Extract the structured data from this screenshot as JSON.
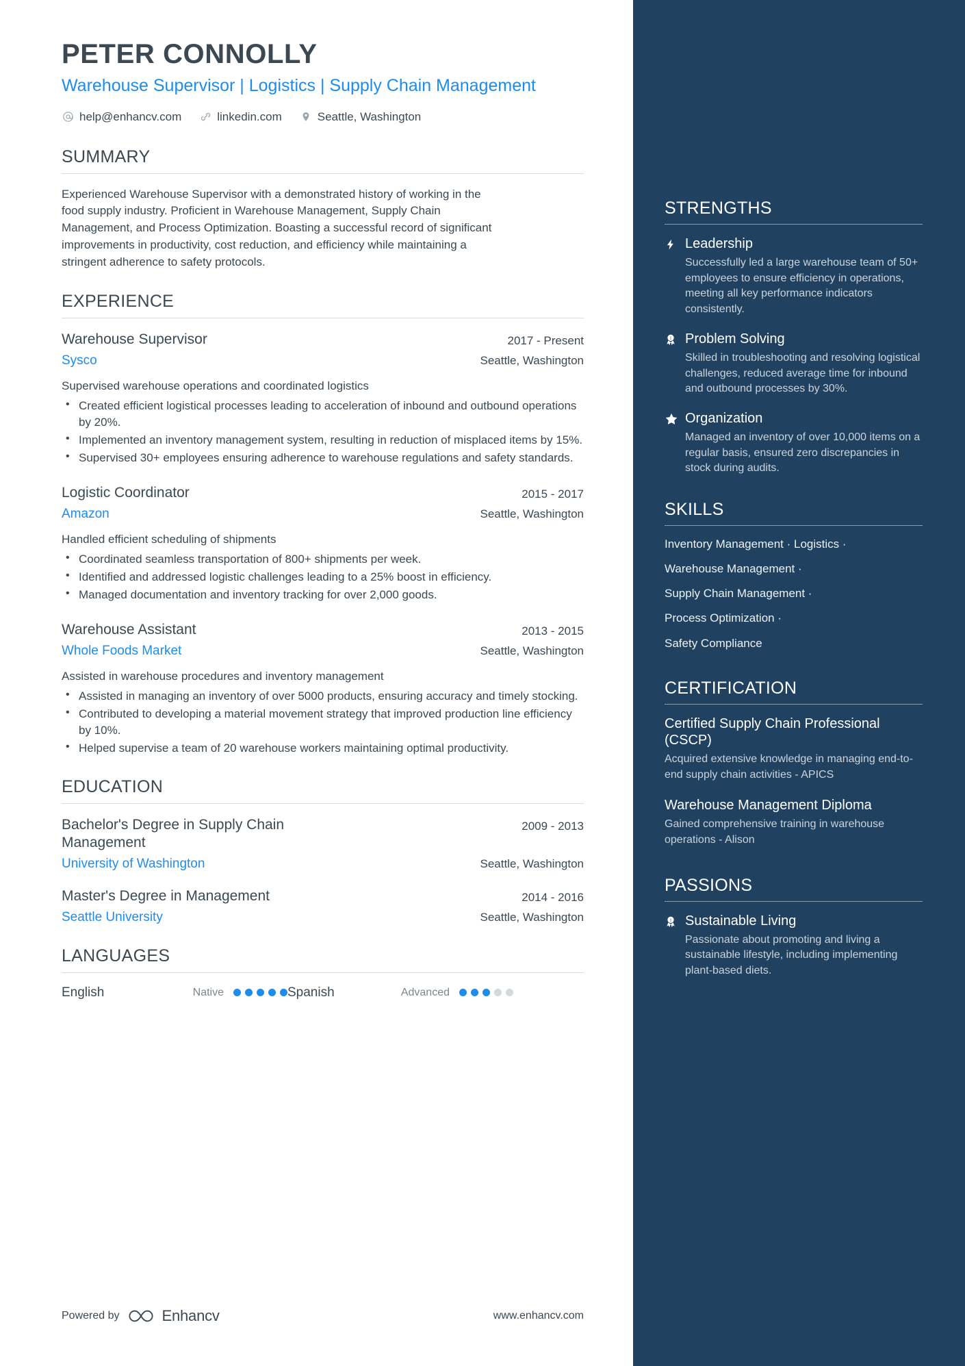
{
  "colors": {
    "accent_blue": "#1f8ceb",
    "sidebar_bg": "#20415f",
    "text_dark": "#3c4852",
    "muted": "#7b868e",
    "sidebar_text_muted": "#cbd4dc"
  },
  "header": {
    "name": "PETER CONNOLLY",
    "headline": "Warehouse Supervisor | Logistics | Supply Chain Management",
    "contacts": [
      {
        "icon": "email-icon",
        "text": "help@enhancv.com"
      },
      {
        "icon": "link-icon",
        "text": "linkedin.com"
      },
      {
        "icon": "location-pin-icon",
        "text": "Seattle, Washington"
      }
    ]
  },
  "summary": {
    "title": "SUMMARY",
    "text": "Experienced Warehouse Supervisor with a demonstrated history of working in the food supply industry. Proficient in Warehouse Management, Supply Chain Management, and Process Optimization. Boasting a successful record of significant improvements in productivity, cost reduction, and efficiency while maintaining a stringent adherence to safety protocols."
  },
  "experience": {
    "title": "EXPERIENCE",
    "entries": [
      {
        "role": "Warehouse Supervisor",
        "date": "2017 - Present",
        "company": "Sysco",
        "location": "Seattle, Washington",
        "description": "Supervised warehouse operations and coordinated logistics",
        "bullets": [
          "Created efficient logistical processes leading to acceleration of inbound and outbound operations by 20%.",
          "Implemented an inventory management system, resulting in reduction of misplaced items by 15%.",
          "Supervised 30+ employees ensuring adherence to warehouse regulations and safety standards."
        ]
      },
      {
        "role": "Logistic Coordinator",
        "date": "2015 - 2017",
        "company": "Amazon",
        "location": "Seattle, Washington",
        "description": "Handled efficient scheduling of shipments",
        "bullets": [
          "Coordinated seamless transportation of 800+ shipments per week.",
          "Identified and addressed logistic challenges leading to a 25% boost in efficiency.",
          "Managed documentation and inventory tracking for over 2,000 goods."
        ]
      },
      {
        "role": "Warehouse Assistant",
        "date": "2013 - 2015",
        "company": "Whole Foods Market",
        "location": "Seattle, Washington",
        "description": "Assisted in warehouse procedures and inventory management",
        "bullets": [
          "Assisted in managing an inventory of over 5000 products, ensuring accuracy and timely stocking.",
          "Contributed to developing a material movement strategy that improved production line efficiency by 10%.",
          "Helped supervise a team of 20 warehouse workers maintaining optimal productivity."
        ]
      }
    ]
  },
  "education": {
    "title": "EDUCATION",
    "entries": [
      {
        "degree": "Bachelor's Degree in Supply Chain Management",
        "date": "2009 - 2013",
        "school": "University of Washington",
        "location": "Seattle, Washington"
      },
      {
        "degree": "Master's Degree in Management",
        "date": "2014 - 2016",
        "school": "Seattle University",
        "location": "Seattle, Washington"
      }
    ]
  },
  "languages": {
    "title": "LANGUAGES",
    "items": [
      {
        "name": "English",
        "level": "Native",
        "filled": 5,
        "total": 5
      },
      {
        "name": "Spanish",
        "level": "Advanced",
        "filled": 3,
        "total": 5
      }
    ]
  },
  "footer": {
    "powered_label": "Powered by",
    "brand": "Enhancv",
    "url": "www.enhancv.com"
  },
  "sidebar": {
    "strengths": {
      "title": "STRENGTHS",
      "items": [
        {
          "icon": "lightning-bolt-icon",
          "name": "Leadership",
          "description": "Successfully led a large warehouse team of 50+ employees to ensure efficiency in operations, meeting all key performance indicators consistently."
        },
        {
          "icon": "award-ribbon-icon",
          "name": "Problem Solving",
          "description": "Skilled in troubleshooting and resolving logistical challenges, reduced average time for inbound and outbound processes by 30%."
        },
        {
          "icon": "star-icon",
          "name": "Organization",
          "description": "Managed an inventory of over 10,000 items on a regular basis, ensured zero discrepancies in stock during audits."
        }
      ]
    },
    "skills": {
      "title": "SKILLS",
      "lines": [
        "Inventory Management · Logistics ·",
        "Warehouse Management ·",
        "Supply Chain Management ·",
        "Process Optimization ·",
        "Safety Compliance"
      ]
    },
    "certification": {
      "title": "CERTIFICATION",
      "items": [
        {
          "name": "Certified Supply Chain Professional (CSCP)",
          "description": "Acquired extensive knowledge in managing end-to-end supply chain activities - APICS"
        },
        {
          "name": "Warehouse Management Diploma",
          "description": "Gained comprehensive training in warehouse operations - Alison"
        }
      ]
    },
    "passions": {
      "title": "PASSIONS",
      "items": [
        {
          "icon": "award-ribbon-icon",
          "name": "Sustainable Living",
          "description": "Passionate about promoting and living a sustainable lifestyle, including implementing plant-based diets."
        }
      ]
    }
  }
}
